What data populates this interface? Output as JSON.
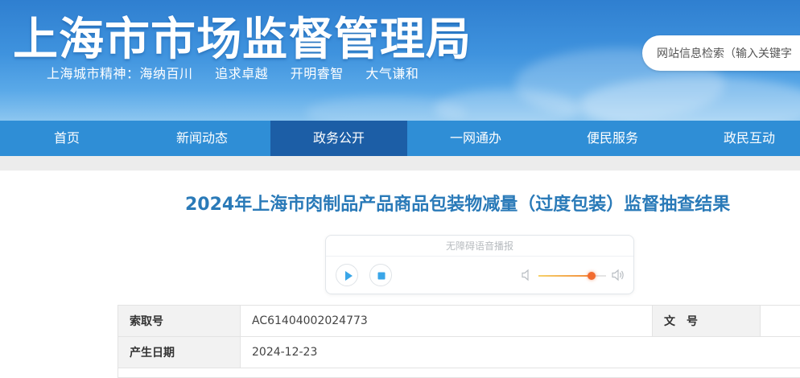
{
  "header": {
    "site_title": "上海市市场监督管理局",
    "motto": [
      "上海城市精神：海纳百川",
      "追求卓越",
      "开明睿智",
      "大气谦和"
    ],
    "search_placeholder": "网站信息检索（输入关键字"
  },
  "nav": {
    "items": [
      "首页",
      "新闻动态",
      "政务公开",
      "一网通办",
      "便民服务",
      "政民互动"
    ],
    "active": "政务公开"
  },
  "article": {
    "title": "2024年上海市肉制品产品商品包装物减量（过度包装）监督抽查结果"
  },
  "player": {
    "label": "无障碍语音播报",
    "volume": 0.78,
    "accent_color": "#f26b2f"
  },
  "info": {
    "rows": [
      {
        "label": "索取号",
        "value": "AC61404002024773",
        "label2": "文　号",
        "value2": ""
      },
      {
        "label": "产生日期",
        "value": "2024-12-23"
      }
    ]
  },
  "colors": {
    "nav_bg": "#2f8ed6",
    "nav_active": "#1c5ea6",
    "title_color": "#2a7ab8"
  }
}
